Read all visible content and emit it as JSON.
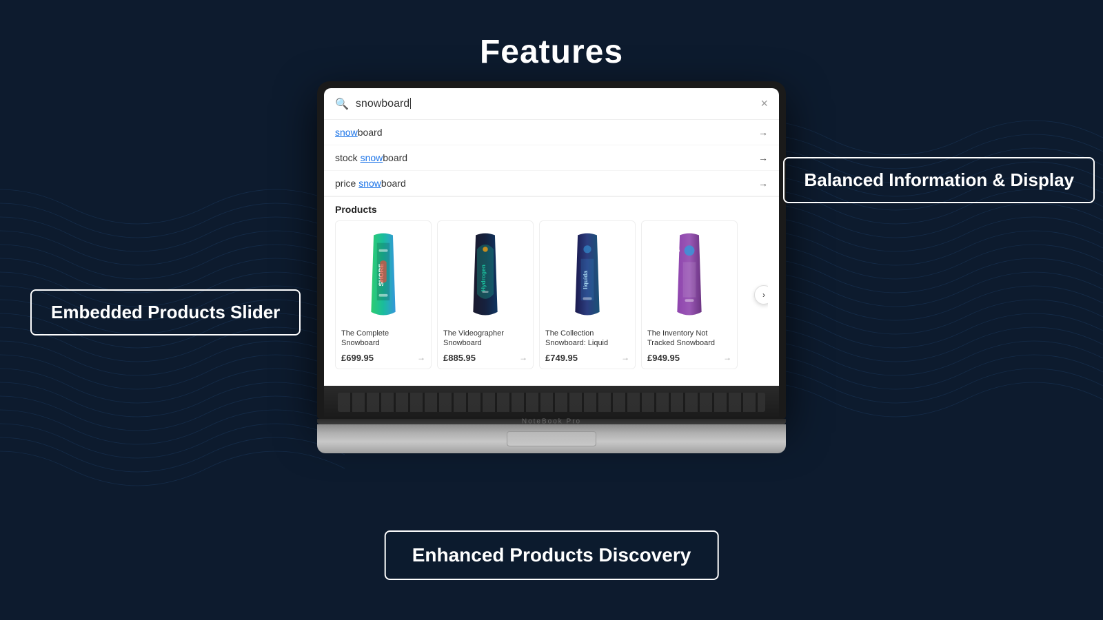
{
  "page": {
    "title": "Features",
    "background_color": "#0d1b2e"
  },
  "labels": {
    "left_feature": "Embedded Products Slider",
    "right_feature": "Balanced Information & Display",
    "bottom_feature": "Enhanced Products Discovery"
  },
  "laptop": {
    "brand": "NoteBook Pro"
  },
  "search": {
    "query": "snowboard",
    "close_icon": "×",
    "suggestions": [
      {
        "pre": "",
        "highlight": "snow",
        "post": "board"
      },
      {
        "pre": "stock ",
        "highlight": "snow",
        "post": "board"
      },
      {
        "pre": "price ",
        "highlight": "snow",
        "post": "board"
      }
    ],
    "products_label": "Products",
    "products": [
      {
        "name": "The Complete Snowboard",
        "price": "£699.95",
        "color1": "#4ecdc4",
        "color2": "#2b9a8a",
        "color3": "#e74c3c"
      },
      {
        "name": "The Videographer Snowboard",
        "price": "£885.95",
        "color1": "#2c3e50",
        "color2": "#1abc9c",
        "color3": "#8e44ad"
      },
      {
        "name": "The Collection Snowboard: Liquid",
        "price": "£749.95",
        "color1": "#2980b9",
        "color2": "#1a5276",
        "color3": "#27ae60"
      },
      {
        "name": "The Inventory Not Tracked Snowboard",
        "price": "£949.95",
        "color1": "#8e44ad",
        "color2": "#6c3483",
        "color3": "#3498db"
      }
    ]
  }
}
